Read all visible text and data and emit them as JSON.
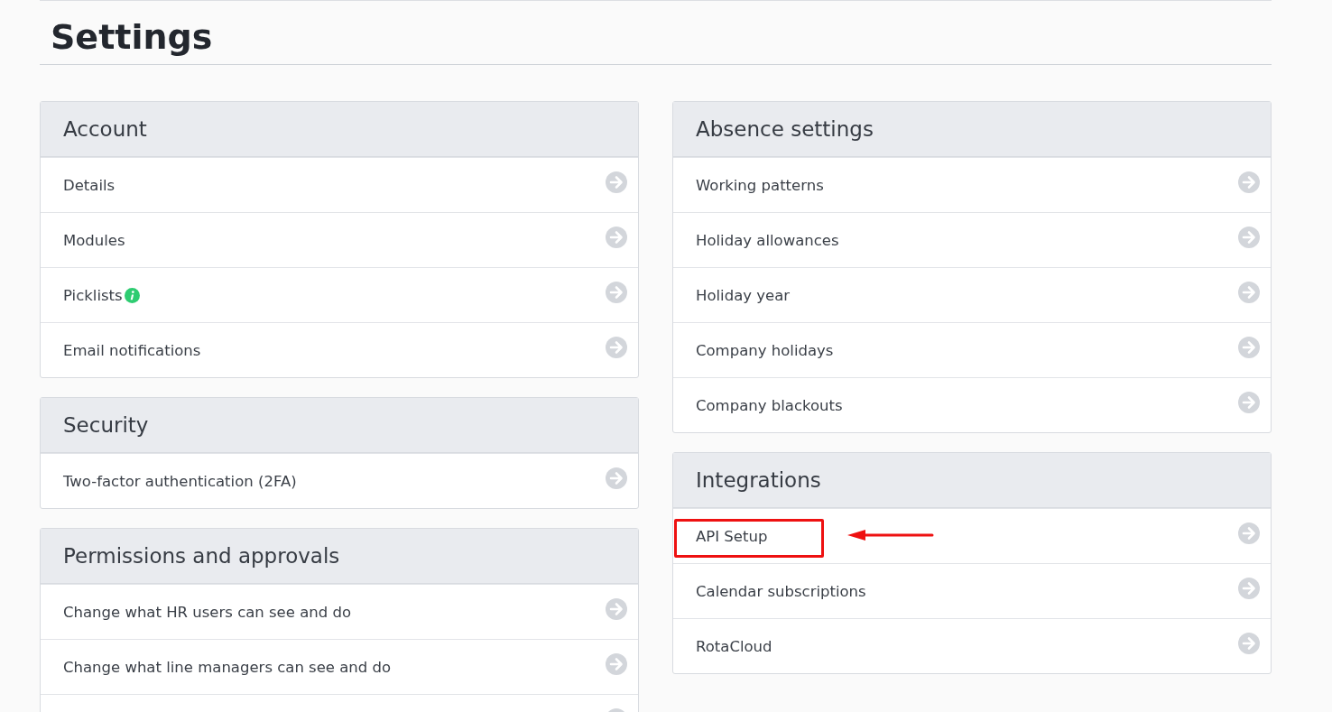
{
  "page": {
    "title": "Settings"
  },
  "columns": [
    {
      "panels": [
        {
          "title": "Account",
          "items": [
            {
              "kind": "link",
              "label": "Details",
              "info": false,
              "highlighted": false
            },
            {
              "kind": "link",
              "label": "Modules",
              "info": false,
              "highlighted": false
            },
            {
              "kind": "link",
              "label": "Picklists",
              "info": true,
              "highlighted": false
            },
            {
              "kind": "link",
              "label": "Email notifications",
              "info": false,
              "highlighted": false
            }
          ]
        },
        {
          "title": "Security",
          "items": [
            {
              "kind": "link",
              "label": "Two-factor authentication (2FA)",
              "info": false,
              "highlighted": false
            }
          ]
        },
        {
          "title": "Permissions and approvals",
          "items": [
            {
              "kind": "link",
              "label": "Change what HR users can see and do",
              "info": false,
              "highlighted": false
            },
            {
              "kind": "link",
              "label": "Change what line managers can see and do",
              "info": false,
              "highlighted": false
            },
            {
              "kind": "cut"
            }
          ]
        }
      ]
    },
    {
      "panels": [
        {
          "title": "Absence settings",
          "items": [
            {
              "kind": "link",
              "label": "Working patterns",
              "info": false,
              "highlighted": false
            },
            {
              "kind": "link",
              "label": "Holiday allowances",
              "info": false,
              "highlighted": false
            },
            {
              "kind": "link",
              "label": "Holiday year",
              "info": false,
              "highlighted": false
            },
            {
              "kind": "link",
              "label": "Company holidays",
              "info": false,
              "highlighted": false
            },
            {
              "kind": "link",
              "label": "Company blackouts",
              "info": false,
              "highlighted": false
            }
          ]
        },
        {
          "title": "Integrations",
          "items": [
            {
              "kind": "link",
              "label": "API Setup",
              "info": false,
              "highlighted": true
            },
            {
              "kind": "link",
              "label": "Calendar subscriptions",
              "info": false,
              "highlighted": false
            },
            {
              "kind": "link",
              "label": "RotaCloud",
              "info": false,
              "highlighted": false
            }
          ]
        }
      ]
    }
  ]
}
